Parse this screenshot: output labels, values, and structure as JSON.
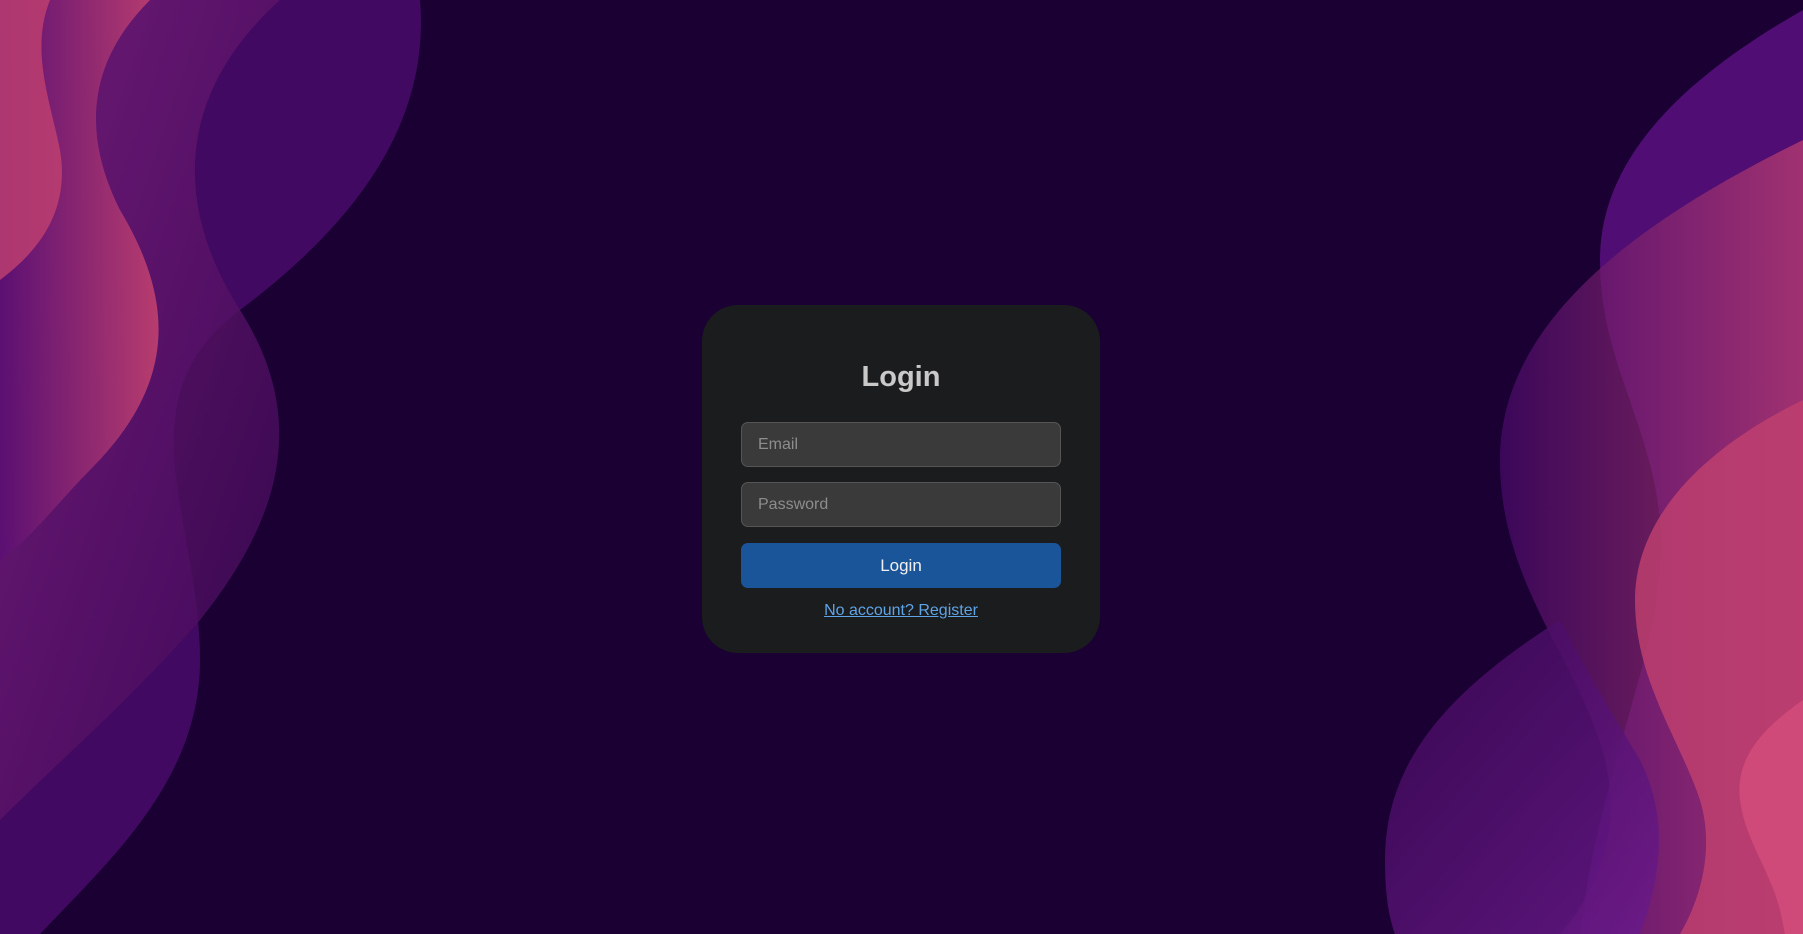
{
  "login": {
    "title": "Login",
    "email_placeholder": "Email",
    "password_placeholder": "Password",
    "button_label": "Login",
    "register_link": "No account? Register"
  },
  "colors": {
    "background": "#1a0033",
    "card": "#1b1c1d",
    "input": "#3a3a3a",
    "button": "#1b5599",
    "link": "#5ea4e6",
    "wave_pink": "#c2416f",
    "wave_purple": "#4a0a6b"
  }
}
